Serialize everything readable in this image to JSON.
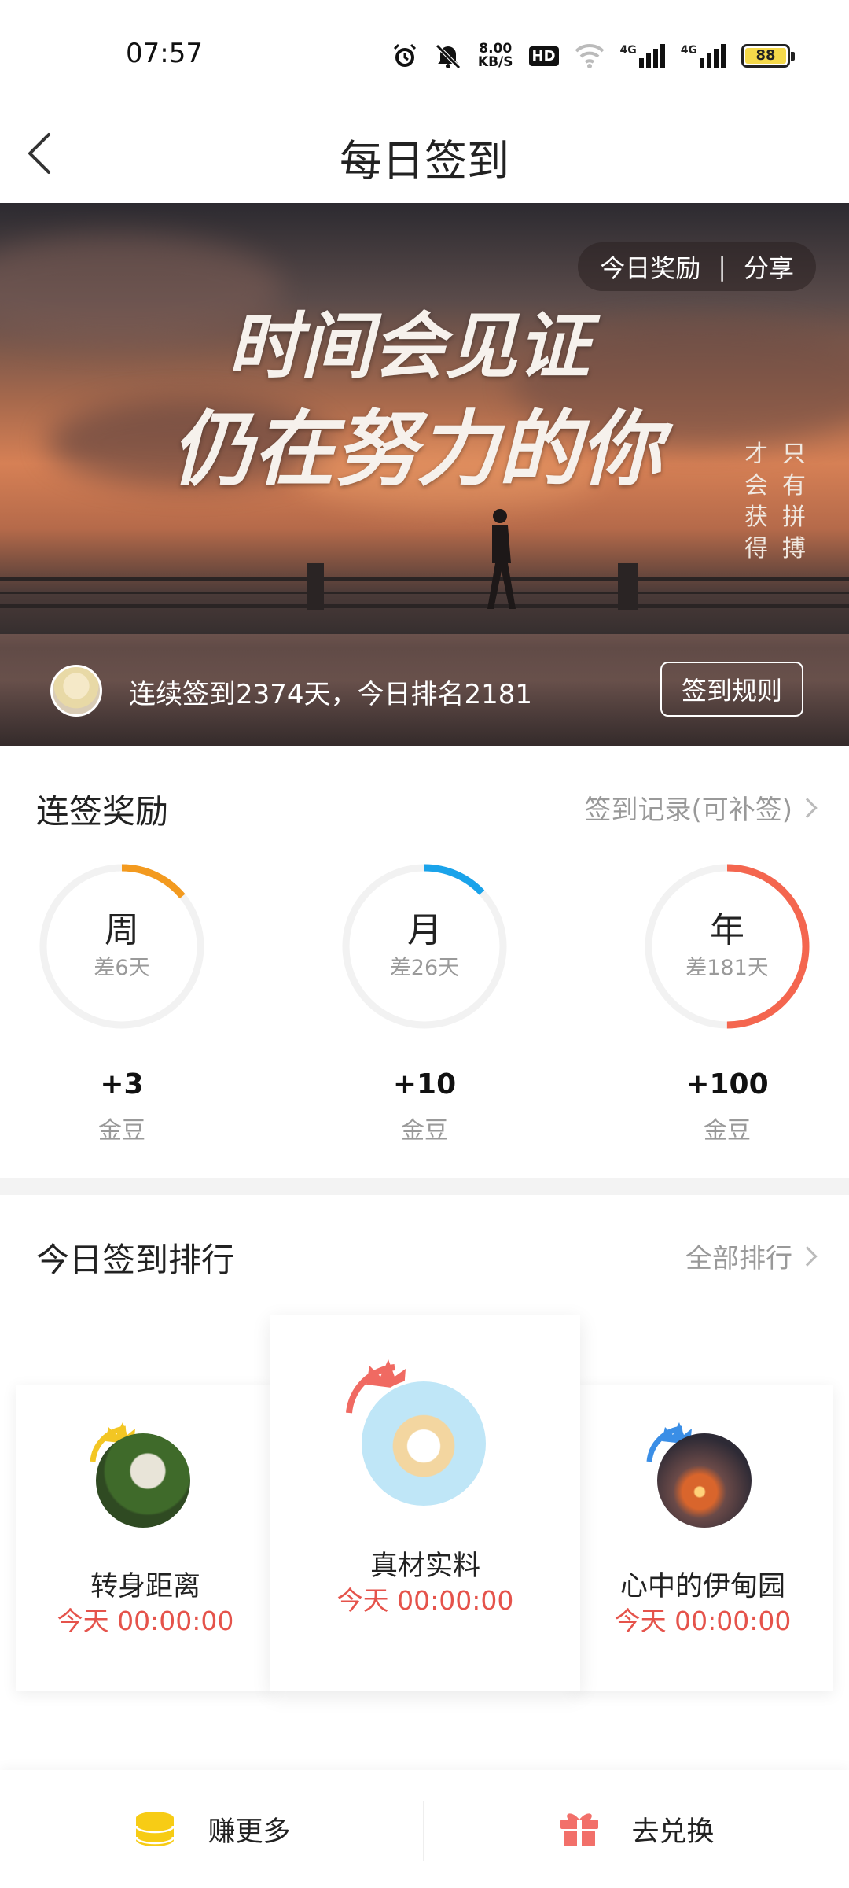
{
  "status_bar": {
    "time": "07:57",
    "net_speed_top": "8.00",
    "net_speed_bottom": "KB/S",
    "hd_badge": "HD",
    "signal_1": "4G",
    "signal_2": "4G",
    "battery": "88",
    "icons": [
      "alarm-icon",
      "mute-icon",
      "hd-icon",
      "wifi-icon",
      "signal-icon",
      "signal-icon",
      "battery-icon"
    ]
  },
  "header": {
    "title": "每日签到",
    "back_icon": "chevron-left-icon"
  },
  "banner": {
    "reward_label": "今日奖励",
    "separator": "|",
    "share_label": "分享",
    "slogan_line1": "时间会见证",
    "slogan_line2": "仍在努力的你",
    "vertical_right": "只有拼搏",
    "vertical_left": "才会获得",
    "streak_text": "连续签到2374天，今日排名2181",
    "rules_button": "签到规则"
  },
  "rewards": {
    "title": "连签奖励",
    "record_link": "签到记录(可补签)",
    "items": [
      {
        "period": "周",
        "remaining": "差6天",
        "amount": "+3",
        "unit": "金豆",
        "progress": 0.14,
        "color": "#f39a1f"
      },
      {
        "period": "月",
        "remaining": "差26天",
        "amount": "+10",
        "unit": "金豆",
        "progress": 0.13,
        "color": "#1aa3ea"
      },
      {
        "period": "年",
        "remaining": "差181天",
        "amount": "+100",
        "unit": "金豆",
        "progress": 0.5,
        "color": "#f4664f"
      }
    ],
    "track_color": "#f2f2f2"
  },
  "ranking": {
    "title": "今日签到排行",
    "all_link": "全部排行",
    "entries": [
      {
        "position": "second",
        "name": "转身距离",
        "time": "今天 00:00:00",
        "crown_color": "#f3c623"
      },
      {
        "position": "first",
        "name": "真材实料",
        "time": "今天 00:00:00",
        "crown_color": "#f06a62"
      },
      {
        "position": "third",
        "name": "心中的伊甸园",
        "time": "今天 00:00:00",
        "crown_color": "#3a8ee6"
      }
    ],
    "time_color": "#e5534b"
  },
  "bottom_bar": {
    "earn_label": "赚更多",
    "earn_icon": "coin-stack-icon",
    "exchange_label": "去兑换",
    "exchange_icon": "gift-icon",
    "earn_icon_color": "#f7cc15",
    "exchange_icon_color": "#f2706a"
  }
}
